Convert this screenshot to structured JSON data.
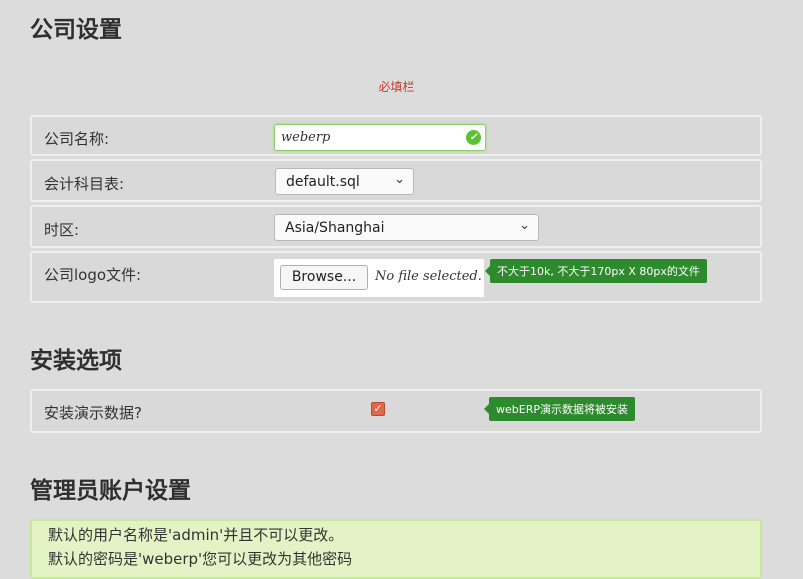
{
  "company_section": {
    "title": "公司设置",
    "required_note": "必填栏",
    "company_name": {
      "label": "公司名称:",
      "value": "weberp"
    },
    "chart_of_accounts": {
      "label": "会计科目表:",
      "selected": "default.sql"
    },
    "timezone": {
      "label": "时区:",
      "selected": "Asia/Shanghai"
    },
    "logo": {
      "label": "公司logo文件:",
      "browse_label": "Browse...",
      "no_file_text": "No file selected.",
      "tooltip": "不大于10k, 不大于170px X 80px的文件"
    }
  },
  "install_section": {
    "title": "安装选项",
    "demo_data": {
      "label": "安装演示数据?",
      "checked": true,
      "tooltip": "webERP演示数据将被安装"
    }
  },
  "admin_section": {
    "title": "管理员账户设置",
    "info_line1": "默认的用户名称是'admin'并且不可以更改。",
    "info_line2": "默认的密码是'weberp'您可以更改为其他密码"
  },
  "colors": {
    "tooltip_bg": "#2d8a2d",
    "required_text": "#c0392b",
    "checkbox_accent": "#e2674a",
    "info_bg": "#e4f3c6"
  },
  "icons": {
    "valid": "check-circle-icon",
    "dropdown": "chevron-down-icon",
    "checkbox": "checkmark-icon"
  }
}
